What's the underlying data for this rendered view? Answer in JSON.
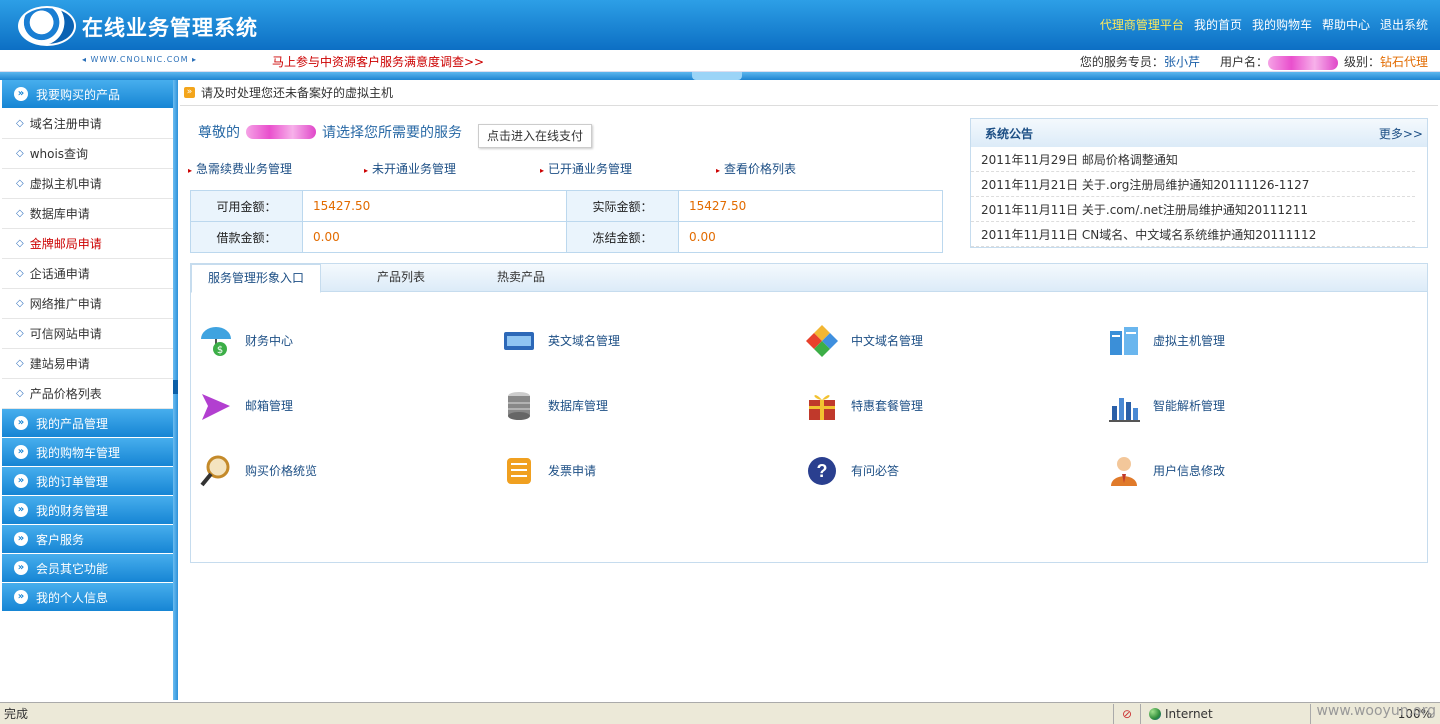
{
  "header": {
    "system_title": "在线业务管理系统",
    "site_url": "◂ WWW.CNOLNIC.COM ▸",
    "nav": [
      "代理商管理平台",
      "我的首页",
      "我的购物车",
      "帮助中心",
      "退出系统"
    ],
    "survey": "马上参与中资源客户服务满意度调查>>",
    "service_label": "您的服务专员：",
    "service_name": "张小芹",
    "user_label": "用户名：",
    "level_label": "级别：",
    "level_value": "钻石代理"
  },
  "sidebar": {
    "head": "我要购买的产品",
    "items": [
      "域名注册申请",
      "whois查询",
      "虚拟主机申请",
      "数据库申请",
      "金牌邮局申请",
      "企话通申请",
      "网络推广申请",
      "可信网站申请",
      "建站易申请",
      "产品价格列表"
    ],
    "sections": [
      "我的产品管理",
      "我的购物车管理",
      "我的订单管理",
      "我的财务管理",
      "客户服务",
      "会员其它功能",
      "我的个人信息"
    ]
  },
  "notice": "请及时处理您还未备案好的虚拟主机",
  "greeting": {
    "prefix": "尊敬的",
    "suffix": "请选择您所需要的服务"
  },
  "pay_button": "点击进入在线支付",
  "links": [
    "急需续费业务管理",
    "未开通业务管理",
    "已开通业务管理",
    "查看价格列表"
  ],
  "amounts": {
    "available_label": "可用金额：",
    "available_value": "15427.50",
    "actual_label": "实际金额：",
    "actual_value": "15427.50",
    "loan_label": "借款金额：",
    "loan_value": "0.00",
    "frozen_label": "冻结金额：",
    "frozen_value": "0.00"
  },
  "announcement": {
    "title": "系统公告",
    "more": "更多>>",
    "items": [
      "2011年11月29日 邮局价格调整通知",
      "2011年11月21日 关于.org注册局维护通知20111126-1127",
      "2011年11月11日 关于.com/.net注册局维护通知20111211",
      "2011年11月11日 CN域名、中文域名系统维护通知20111112"
    ]
  },
  "tabs": [
    "服务管理形象入口",
    "产品列表",
    "热卖产品"
  ],
  "services": [
    {
      "label": "财务中心",
      "icon": "umbrella-money-icon",
      "color": "#3fa3e0"
    },
    {
      "label": "英文域名管理",
      "icon": "card-icon",
      "color": "#2c68b8"
    },
    {
      "label": "中文域名管理",
      "icon": "diamond-tiles-icon",
      "color": "#e8412c"
    },
    {
      "label": "虚拟主机管理",
      "icon": "server-icon",
      "color": "#3b8fd8"
    },
    {
      "label": "邮箱管理",
      "icon": "envelope-icon",
      "color": "#b23fd0"
    },
    {
      "label": "数据库管理",
      "icon": "database-icon",
      "color": "#888888"
    },
    {
      "label": "特惠套餐管理",
      "icon": "gift-icon",
      "color": "#c0392b"
    },
    {
      "label": "智能解析管理",
      "icon": "bar-chart-icon",
      "color": "#2a5fa8"
    },
    {
      "label": "购买价格统览",
      "icon": "magnifier-icon",
      "color": "#c48a2a"
    },
    {
      "label": "发票申请",
      "icon": "scroll-icon",
      "color": "#f0a020"
    },
    {
      "label": "有问必答",
      "icon": "question-icon",
      "color": "#2a3f8f"
    },
    {
      "label": "用户信息修改",
      "icon": "user-icon",
      "color": "#e07a2a"
    }
  ],
  "statusbar": {
    "text": "完成",
    "zone": "Internet",
    "zoom": "100%",
    "watermark": "www.wooyun.org"
  }
}
